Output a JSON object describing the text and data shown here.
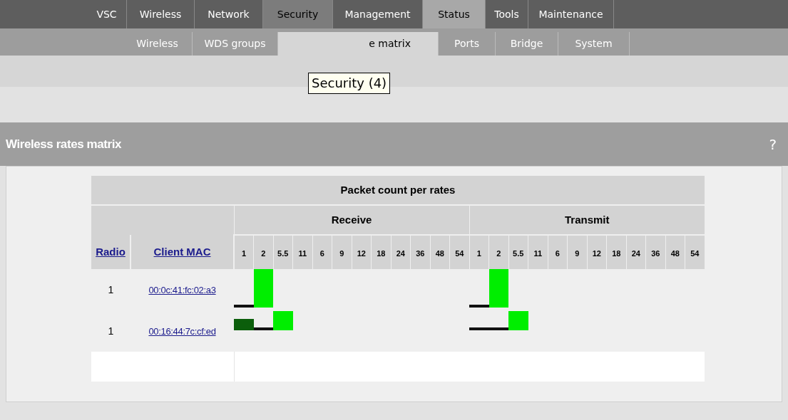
{
  "main_tabs": [
    {
      "label": "VSC",
      "selected": false
    },
    {
      "label": "Wireless",
      "selected": false
    },
    {
      "label": "Network",
      "selected": false
    },
    {
      "label": "Security",
      "selected": false,
      "hovered": true
    },
    {
      "label": "Management",
      "selected": false
    },
    {
      "label": "Status",
      "selected": true
    },
    {
      "label": "Tools",
      "selected": false
    },
    {
      "label": "Maintenance",
      "selected": false
    }
  ],
  "sub_tabs": [
    {
      "label": "Wireless",
      "selected": false
    },
    {
      "label": "WDS groups",
      "selected": false
    },
    {
      "label": "e matrix",
      "selected": true
    },
    {
      "label": "Ports",
      "selected": false
    },
    {
      "label": "Bridge",
      "selected": false
    },
    {
      "label": "System",
      "selected": false
    }
  ],
  "tooltip": "Security (4)",
  "panel": {
    "title": "Wireless rates matrix",
    "help": "?"
  },
  "table": {
    "title": "Packet count per rates",
    "groups": [
      "Receive",
      "Transmit"
    ],
    "columns": [
      "Radio",
      "Client MAC"
    ],
    "receive_rates": [
      "1",
      "2",
      "5.5",
      "11",
      "6",
      "9",
      "12",
      "18",
      "24",
      "36",
      "48",
      "54"
    ],
    "transmit_rates": [
      "1",
      "2",
      "5.5",
      "11",
      "6",
      "9",
      "12",
      "18",
      "24",
      "36",
      "48",
      "54"
    ],
    "rows": [
      {
        "radio": "1",
        "mac": "00:0c:41:fc:02:a3",
        "receive": [
          {
            "kind": "line",
            "color": "#111111"
          },
          {
            "kind": "tall",
            "color": "#00ee00"
          }
        ],
        "transmit": [
          {
            "kind": "line",
            "color": "#111111"
          },
          {
            "kind": "tall",
            "color": "#00ee00"
          }
        ]
      },
      {
        "radio": "1",
        "mac": "00:16:44:7c:cf:ed",
        "receive": [
          {
            "kind": "block",
            "color": "#0b5e0b"
          },
          {
            "kind": "line",
            "color": "#111111"
          },
          {
            "kind": "tall",
            "color": "#00ee00"
          }
        ],
        "transmit": [
          {
            "kind": "line",
            "color": "#111111"
          },
          {
            "kind": "line",
            "color": "#111111"
          },
          {
            "kind": "tall",
            "color": "#00ee00"
          }
        ]
      }
    ]
  }
}
